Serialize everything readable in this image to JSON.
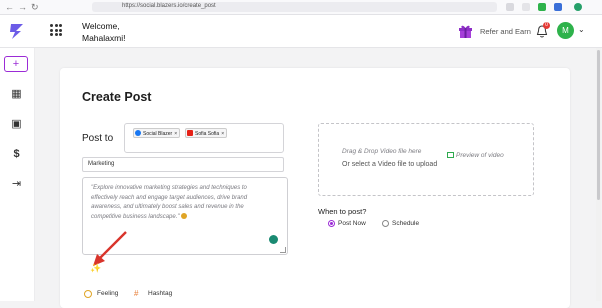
{
  "browser": {
    "url": "https://social.blazers.io/create_post",
    "nav_icons": [
      "back-icon",
      "forward-icon",
      "reload-icon"
    ]
  },
  "header": {
    "greeting": "Welcome,",
    "user_name": "Mahalaxmi!",
    "refer_label": "Refer and Earn",
    "notification_count": "0",
    "avatar_initial": "M"
  },
  "sidebar": {
    "items": [
      {
        "icon": "plus-icon",
        "glyph": "+"
      },
      {
        "icon": "dashboard-icon",
        "glyph": "▦"
      },
      {
        "icon": "calendar-icon",
        "glyph": "▣"
      },
      {
        "icon": "dollar-icon",
        "glyph": "$"
      },
      {
        "icon": "logout-icon",
        "glyph": "⇥"
      }
    ]
  },
  "form": {
    "title": "Create Post",
    "post_to_label": "Post to",
    "accounts": [
      {
        "name": "Social Blazer",
        "platform": "facebook",
        "color": "#1877f2"
      },
      {
        "name": "Sofia Sofia",
        "platform": "youtube",
        "color": "#e62117"
      }
    ],
    "topic_value": "Marketing",
    "content_text": "\"Explore innovative marketing strategies and techniques to effectively reach and engage target audiences, drive brand awareness, and ultimately boost sales and revenue in the competitive business landscape.\"",
    "feeling_label": "Feeling",
    "hashtag_label": "Hashtag",
    "dropzone_line1": "Drag & Drop Video file here",
    "dropzone_line2": "Or select a Video file to upload",
    "preview_label": "Preview of video",
    "when_label": "When to post?",
    "schedule_options": [
      {
        "label": "Post Now",
        "selected": true
      },
      {
        "label": "Schedule",
        "selected": false
      }
    ]
  },
  "colors": {
    "accent": "#9b2bd6",
    "avatar": "#2eb24b",
    "badge": "#e53935"
  }
}
